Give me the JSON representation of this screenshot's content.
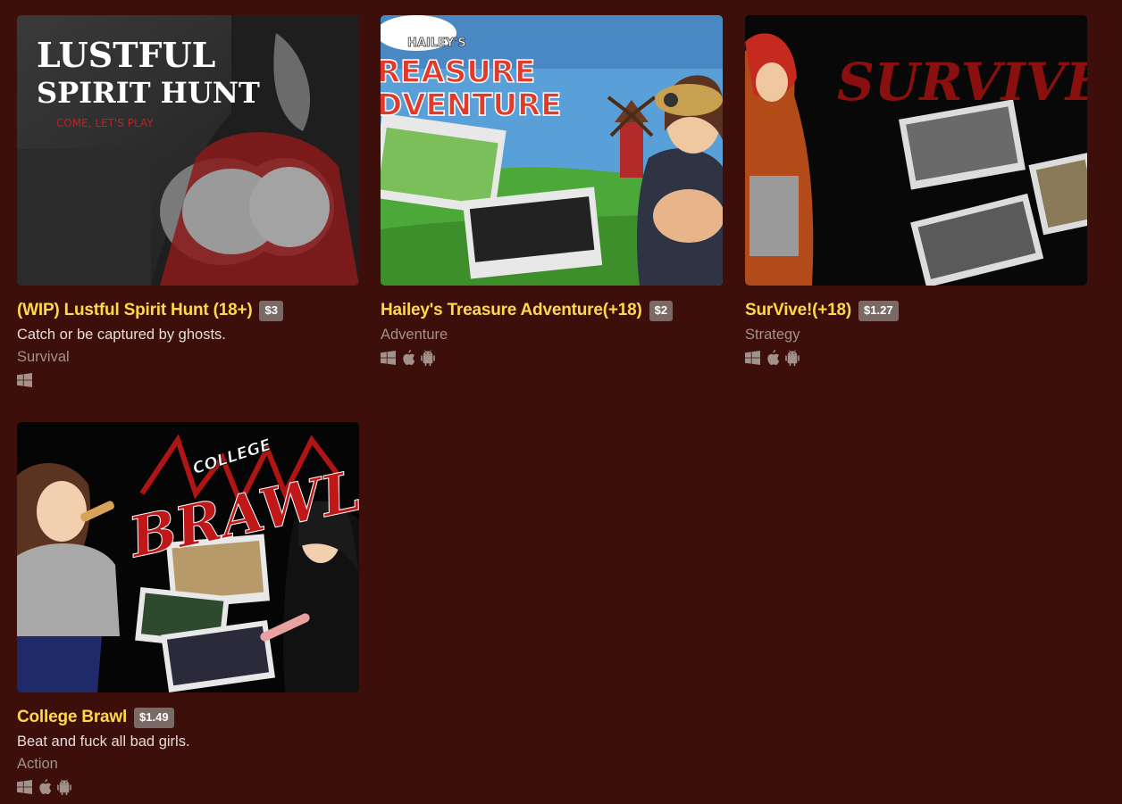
{
  "games": [
    {
      "title": "(WIP) Lustful Spirit Hunt (18+)",
      "price": "$3",
      "description": "Catch or be captured by ghosts.",
      "genre": "Survival",
      "platforms": [
        "windows-icon"
      ],
      "cover_text": {
        "line1": "LUSTFUL",
        "line2": "SPIRIT HUNT",
        "tagline": "COME, LET'S PLAY"
      }
    },
    {
      "title": "Hailey's Treasure Adventure(+18)",
      "price": "$2",
      "description": "",
      "genre": "Adventure",
      "platforms": [
        "windows-icon",
        "apple-icon",
        "android-icon"
      ],
      "cover_text": {
        "small": "HAILEY'S",
        "line1": "REASURE",
        "line2": "DVENTURE"
      }
    },
    {
      "title": "SurVive!(+18)",
      "price": "$1.27",
      "description": "",
      "genre": "Strategy",
      "platforms": [
        "windows-icon",
        "apple-icon",
        "android-icon"
      ],
      "cover_text": {
        "line1": "SURVIVE"
      }
    },
    {
      "title": "College Brawl",
      "price": "$1.49",
      "description": "Beat and fuck all bad girls.",
      "genre": "Action",
      "platforms": [
        "windows-icon",
        "apple-icon",
        "android-icon"
      ],
      "cover_text": {
        "small": "COLLEGE",
        "line1": "BRAWL"
      }
    }
  ],
  "colors": {
    "background": "#3d0f0b",
    "title": "#ffd84a",
    "price_badge": "#7a6a66",
    "genre": "#a3918c",
    "icon": "#a3918c"
  }
}
